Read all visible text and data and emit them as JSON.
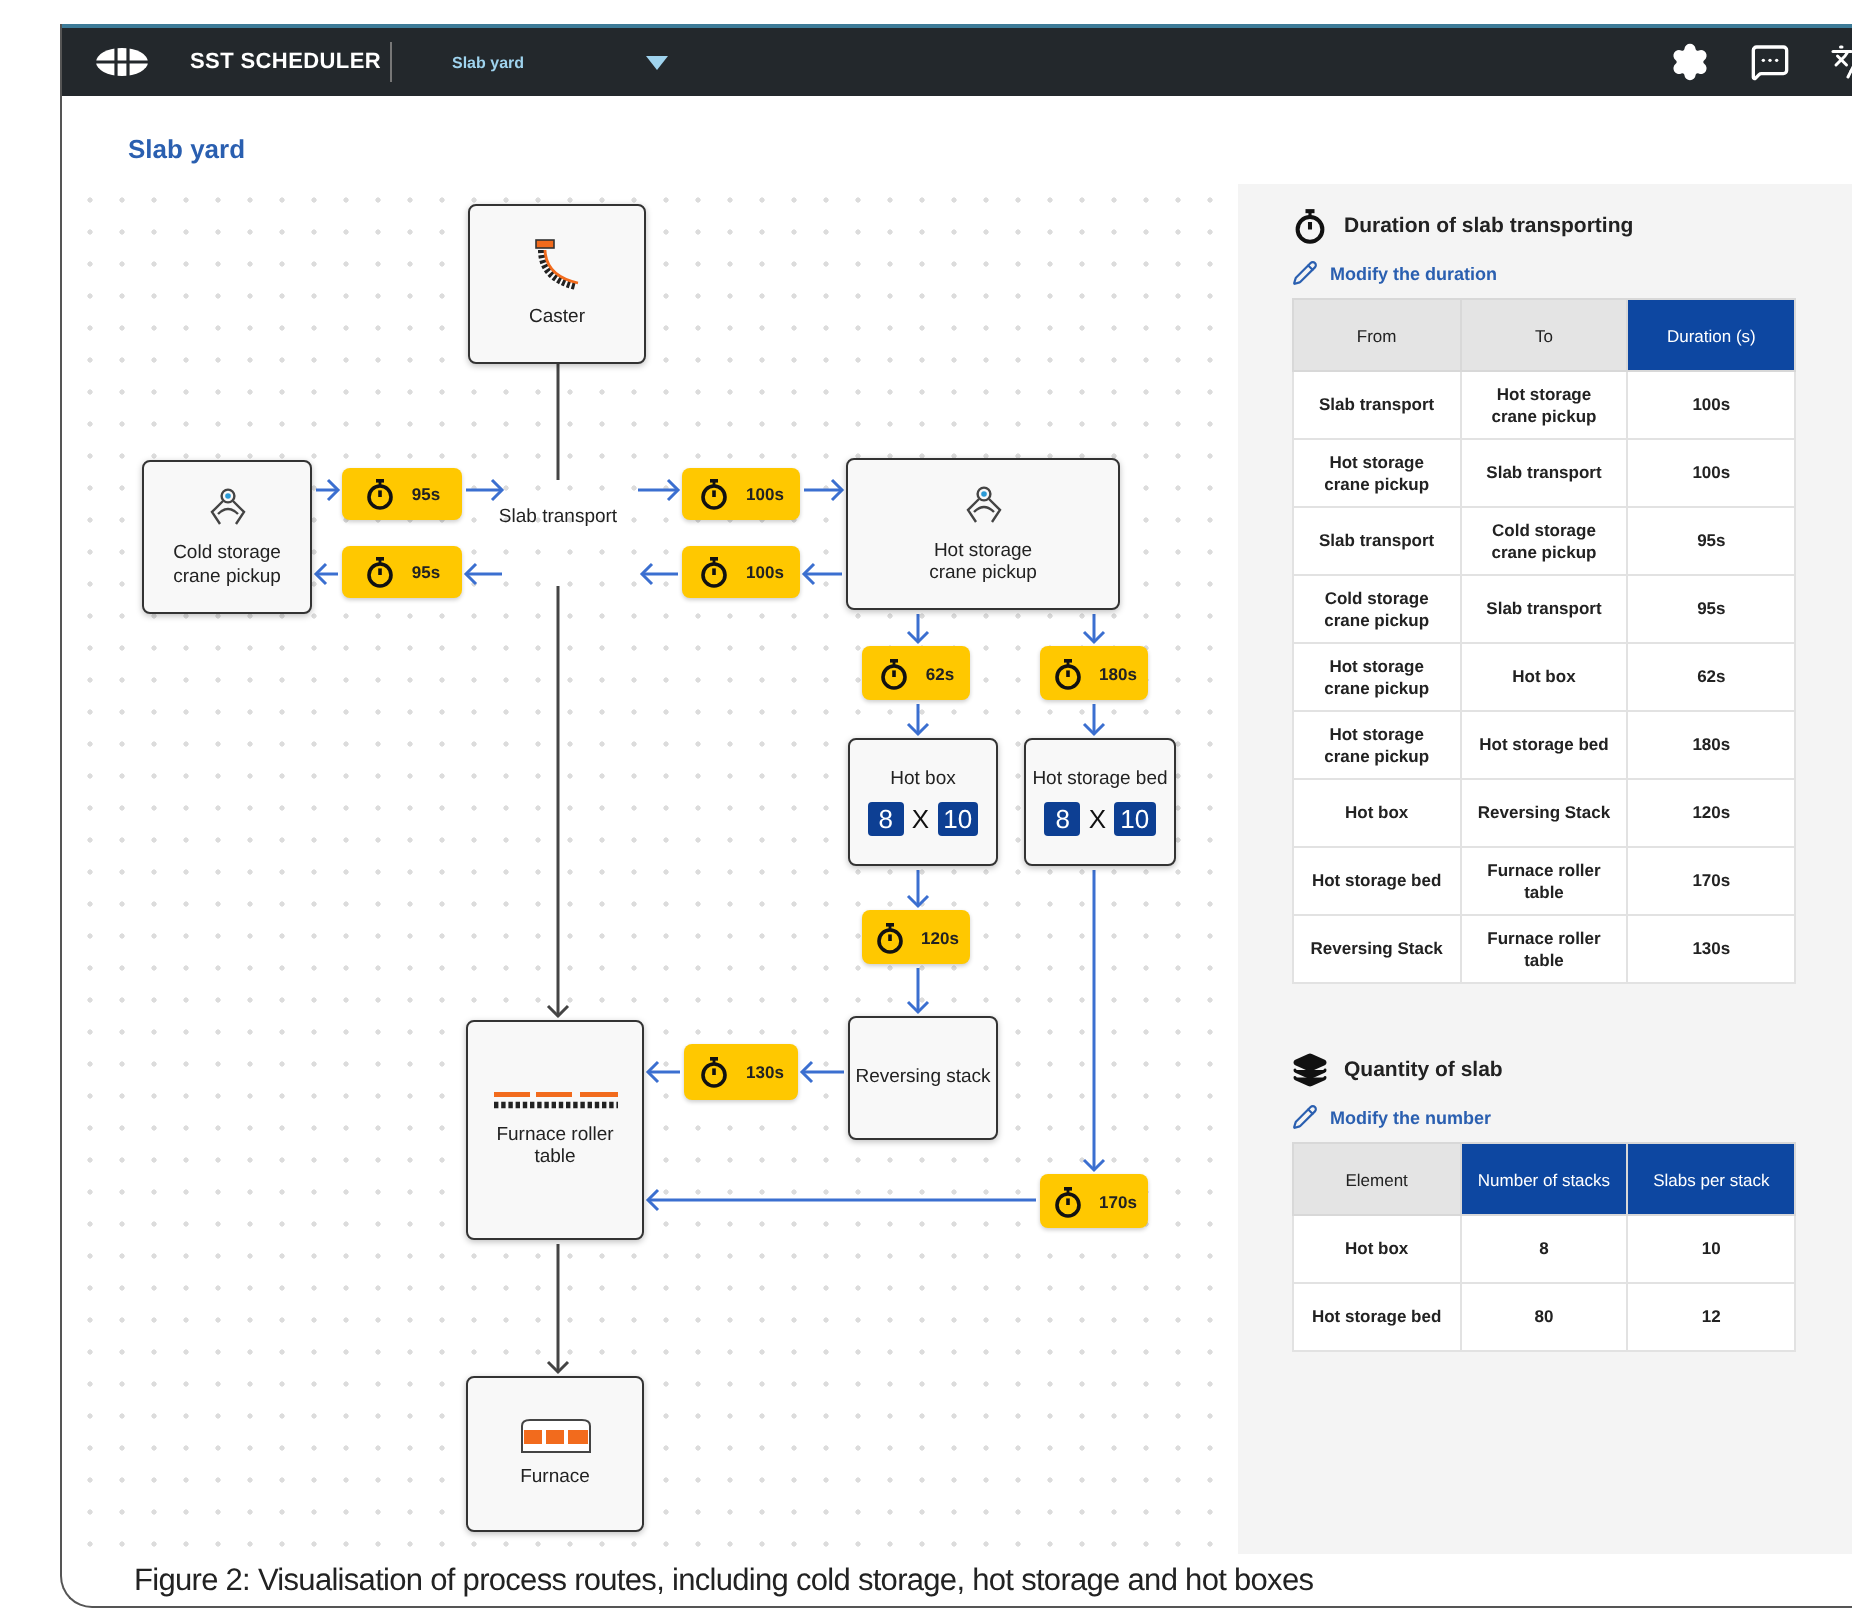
{
  "app": {
    "name": "SST SCHEDULER",
    "area": "Slab yard"
  },
  "page_title": "Slab yard",
  "diagram": {
    "nodes": [
      {
        "kind": "caster",
        "label": "Caster"
      },
      {
        "kind": "crane",
        "label": "Cold storage crane pickup"
      },
      {
        "kind": "junction",
        "label": "Slab transport"
      },
      {
        "kind": "crane",
        "label": "Hot storage crane pickup"
      },
      {
        "kind": "grid",
        "label": "Hot box",
        "stacks": "8",
        "times": "X",
        "per_stack": "10"
      },
      {
        "kind": "grid",
        "label": "Hot storage bed",
        "stacks": "8",
        "times": "X",
        "per_stack": "10"
      },
      {
        "kind": "plain",
        "label": "Reversing stack"
      },
      {
        "kind": "roller",
        "label": "Furnace roller table"
      },
      {
        "kind": "furnace",
        "label": "Furnace"
      }
    ],
    "timers": [
      "95s",
      "95s",
      "100s",
      "100s",
      "62s",
      "180s",
      "120s",
      "130s",
      "170s"
    ]
  },
  "duration_panel": {
    "title": "Duration of slab transporting",
    "link": "Modify the duration",
    "columns": [
      {
        "label": "From",
        "highlighted": false
      },
      {
        "label": "To",
        "highlighted": false
      },
      {
        "label": "Duration (s)",
        "highlighted": true
      }
    ],
    "rows": [
      [
        "Slab transport",
        "Hot storage crane pickup",
        "100s"
      ],
      [
        "Hot storage crane pickup",
        "Slab transport",
        "100s"
      ],
      [
        "Slab transport",
        "Cold storage crane pickup",
        "95s"
      ],
      [
        "Cold storage crane pickup",
        "Slab transport",
        "95s"
      ],
      [
        "Hot storage crane pickup",
        "Hot box",
        "62s"
      ],
      [
        "Hot storage crane pickup",
        "Hot storage bed",
        "180s"
      ],
      [
        "Hot box",
        "Reversing Stack",
        "120s"
      ],
      [
        "Hot storage bed",
        "Furnace roller table",
        "170s"
      ],
      [
        "Reversing Stack",
        "Furnace roller table",
        "130s"
      ]
    ]
  },
  "quantity_panel": {
    "title": "Quantity of slab",
    "link": "Modify the number",
    "columns": [
      {
        "label": "Element",
        "highlighted": false
      },
      {
        "label": "Number of stacks",
        "highlighted": true
      },
      {
        "label": "Slabs per stack",
        "highlighted": true
      }
    ],
    "rows": [
      [
        "Hot box",
        "8",
        "10"
      ],
      [
        "Hot storage bed",
        "80",
        "12"
      ]
    ]
  },
  "caption": "Figure 2: Visualisation of process routes, including cold storage, hot storage and hot boxes"
}
